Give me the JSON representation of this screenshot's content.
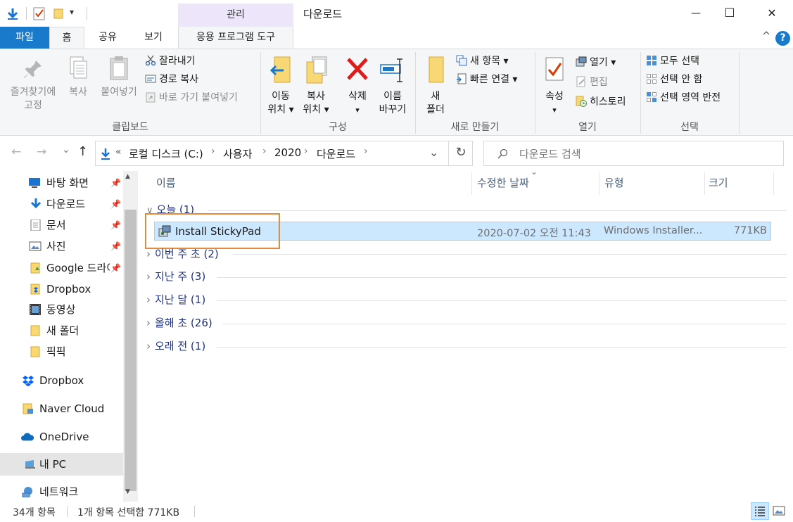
{
  "window": {
    "title": "다운로드",
    "context_tab_header": "관리",
    "controls": {
      "minimize": "—",
      "maximize": "☐",
      "close": "✕"
    }
  },
  "qat": {
    "dropdown_glyph": "▾"
  },
  "tabs": {
    "file": "파일",
    "home": "홈",
    "share": "공유",
    "view": "보기",
    "app_tools": "응용 프로그램 도구",
    "collapse_glyph": "^",
    "help_glyph": "?"
  },
  "ribbon": {
    "clipboard": {
      "group_label": "클립보드",
      "pin_quick_l1": "즐겨찾기에",
      "pin_quick_l2": "고정",
      "copy": "복사",
      "paste": "붙여넣기",
      "cut": "잘라내기",
      "copy_path": "경로 복사",
      "paste_shortcut": "바로 가기 붙여넣기"
    },
    "organize": {
      "group_label": "구성",
      "move_l1": "이동",
      "move_l2": "위치 ▾",
      "copyto_l1": "복사",
      "copyto_l2": "위치 ▾",
      "delete_l1": "삭제",
      "delete_l2": "▾",
      "rename_l1": "이름",
      "rename_l2": "바꾸기"
    },
    "new": {
      "group_label": "새로 만들기",
      "new_folder_l1": "새",
      "new_folder_l2": "폴더",
      "new_item": "새 항목 ▾",
      "easy_access": "빠른 연결 ▾"
    },
    "open": {
      "group_label": "열기",
      "properties_l1": "속성",
      "properties_l2": "▾",
      "open": "열기 ▾",
      "edit": "편집",
      "history": "히스토리"
    },
    "select": {
      "group_label": "선택",
      "select_all": "모두 선택",
      "select_none": "선택 안 함",
      "invert": "선택 영역 반전"
    }
  },
  "address": {
    "crumb_overflow": "«",
    "crumbs": [
      "로컬 디스크 (C:)",
      "사용자",
      "2020",
      "다운로드"
    ],
    "crumb_sep": "›",
    "dropdown_glyph": "⌄",
    "refresh_glyph": "↻",
    "search_placeholder": "다운로드 검색"
  },
  "nav": {
    "back": "←",
    "forward": "→",
    "recent": "⌄",
    "up": "↑",
    "scroll_up": "▲",
    "scroll_down": "▼",
    "pin_glyph": "📌",
    "quick_items": [
      "바탕 화면",
      "다운로드",
      "문서",
      "사진",
      "Google 드라이브",
      "Dropbox",
      "동영상",
      "새 폴더",
      "픽픽"
    ],
    "roots": [
      "Dropbox",
      "Naver Cloud",
      "OneDrive",
      "내 PC",
      "네트워크"
    ]
  },
  "columns": {
    "name": "이름",
    "modified": "수정한 날짜",
    "type": "유형",
    "size": "크기",
    "sort_glyph": "⌄"
  },
  "groups": {
    "today": "오늘 (1)",
    "this_week": "이번 주 초 (2)",
    "last_week": "지난 주 (3)",
    "last_month": "지난 달 (1)",
    "early_year": "올해 초 (26)",
    "long_ago": "오래 전 (1)",
    "expanded_glyph": "∨",
    "collapsed_glyph": "›"
  },
  "files": [
    {
      "name": "Install StickyPad",
      "modified": "2020-07-02 오전 11:43",
      "type": "Windows Installer...",
      "size": "771KB"
    }
  ],
  "status": {
    "count": "34개 항목",
    "selected": "1개 항목 선택함 771KB"
  },
  "colors": {
    "accent": "#1979ca",
    "selection": "#cce8ff",
    "selection_border": "#99d1ff",
    "highlight_box": "#e8893a",
    "context_tab": "#ede6fa"
  }
}
